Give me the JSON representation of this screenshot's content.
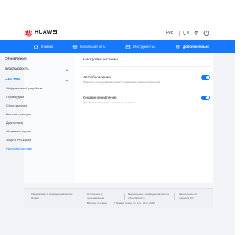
{
  "header": {
    "brand": "HUAWEI",
    "language": "Рус"
  },
  "nav": {
    "items": [
      {
        "label": "Главная",
        "icon": "home-icon"
      },
      {
        "label": "Мобильная сеть",
        "icon": "globe-icon"
      },
      {
        "label": "Инструменты",
        "icon": "toolbox-icon"
      },
      {
        "label": "Дополнительно",
        "icon": "gear-icon",
        "active": true
      }
    ]
  },
  "sidebar": {
    "updates": "Обновления",
    "security": "Безопасность",
    "system": "Система",
    "sub_items": [
      "Информация об устройстве",
      "Перезагрузка",
      "Сброс настроек",
      "Быстрая проверка",
      "Диагностика",
      "Изменение пароля",
      "Защита PIN-кодом",
      "Настройки системы"
    ]
  },
  "main": {
    "title": "Настройки системы",
    "auto_update": {
      "label": "Автообновление",
      "desc": "Позволяет роутеру автоматически устанавливать важные обновления",
      "enabled": true
    },
    "online_update": {
      "label": "Онлайн-обновление",
      "desc": "Для обновления роутер и система не требуются",
      "enabled": true
    }
  },
  "footer": {
    "col1_line1": "Уведомление о конфиденциальности",
    "col1_line2": "Huawei",
    "col2_line1": "Соглашение с",
    "col2_line2": "пользователем",
    "col2_line3": "Вопросы и ответы",
    "col3_line1": "Уведомление о конфиденциальности",
    "col3_line2": "и безопасности",
    "col3_line3": "© Huawei Device Co., Ltd., 2017–2020",
    "col4_line1": "Уведомление об",
    "col4_line2": "открытом ПО"
  },
  "colors": {
    "accent": "#1677ff",
    "brand_red": "#e60012",
    "page_bg": "#f2f4f7"
  }
}
